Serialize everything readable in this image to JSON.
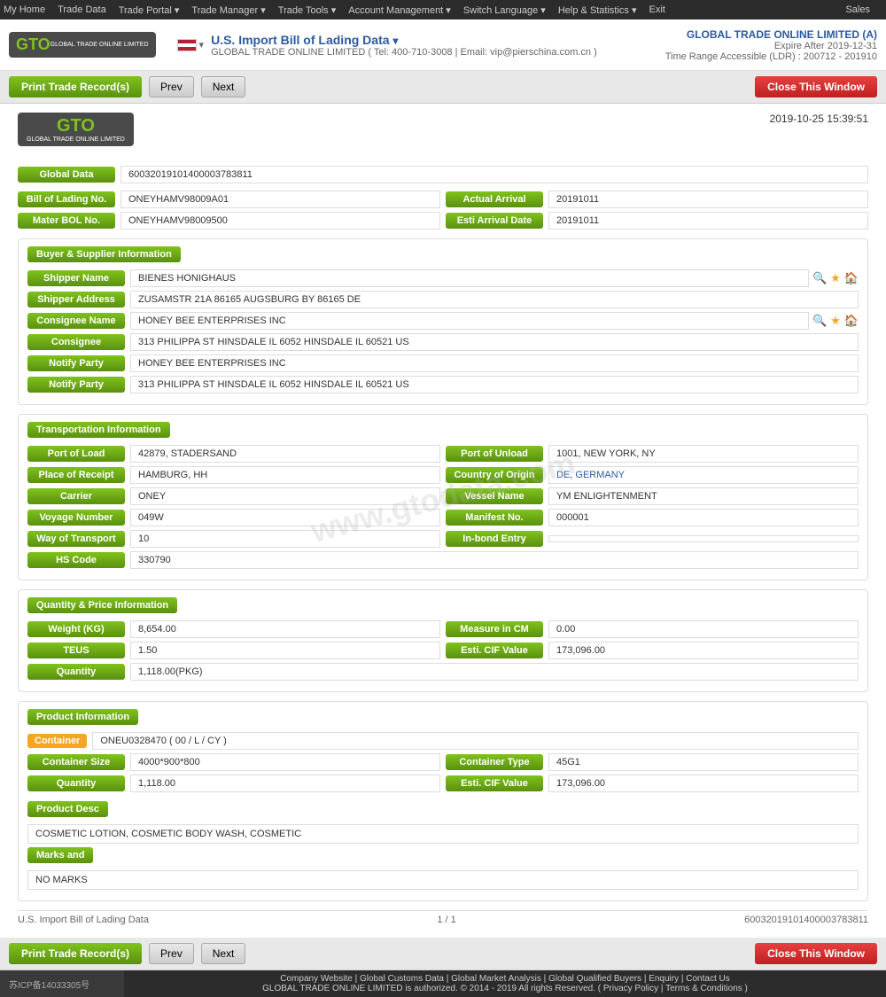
{
  "topnav": {
    "items": [
      "My Home",
      "Trade Data",
      "Trade Portal",
      "Trade Manager",
      "Trade Tools",
      "Account Management",
      "Switch Language",
      "Help & Statistics",
      "Exit"
    ],
    "sales": "Sales"
  },
  "header": {
    "logo_text": "GTO",
    "logo_sub": "GLOBAL TRADE ONLINE LIMITED",
    "flag_alt": "US Flag",
    "title": "U.S. Import Bill of Lading Data",
    "subtitle_company": "GLOBAL TRADE ONLINE LIMITED",
    "subtitle_tel": "Tel: 400-710-3008",
    "subtitle_email": "Email: vip@pierschina.com.cn",
    "account_name": "GLOBAL TRADE ONLINE LIMITED (A)",
    "expire": "Expire After 2019-12-31",
    "time_range": "Time Range Accessible (LDR) : 200712 - 201910"
  },
  "toolbar": {
    "print_label": "Print Trade Record(s)",
    "prev_label": "Prev",
    "next_label": "Next",
    "close_label": "Close This Window"
  },
  "doc": {
    "timestamp": "2019-10-25 15:39:51",
    "global_data_label": "Global Data",
    "global_data_value": "60032019101400003783811",
    "bol_label": "Bill of Lading No.",
    "bol_value": "ONEYHAMV98009A01",
    "actual_arrival_label": "Actual Arrival",
    "actual_arrival_value": "20191011",
    "master_bol_label": "Mater BOL No.",
    "master_bol_value": "ONEYHAMV98009500",
    "esti_arrival_label": "Esti Arrival Date",
    "esti_arrival_value": "20191011",
    "buyer_supplier_title": "Buyer & Supplier Information",
    "shipper_name_label": "Shipper Name",
    "shipper_name_value": "BIENES HONIGHAUS",
    "shipper_address_label": "Shipper Address",
    "shipper_address_value": "ZUSAMSTR 21A 86165 AUGSBURG BY 86165 DE",
    "consignee_name_label": "Consignee Name",
    "consignee_name_value": "HONEY BEE ENTERPRISES INC",
    "consignee_label": "Consignee",
    "consignee_value": "313 PHILIPPA ST HINSDALE IL 6052 HINSDALE IL 60521 US",
    "notify_party_label": "Notify Party",
    "notify_party_value": "HONEY BEE ENTERPRISES INC",
    "notify_party2_label": "Notify Party",
    "notify_party2_value": "313 PHILIPPA ST HINSDALE IL 6052 HINSDALE IL 60521 US",
    "transport_title": "Transportation Information",
    "port_of_load_label": "Port of Load",
    "port_of_load_value": "42879, STADERSAND",
    "port_of_unload_label": "Port of Unload",
    "port_of_unload_value": "1001, NEW YORK, NY",
    "place_of_receipt_label": "Place of Receipt",
    "place_of_receipt_value": "HAMBURG, HH",
    "country_of_origin_label": "Country of Origin",
    "country_of_origin_value": "DE, GERMANY",
    "carrier_label": "Carrier",
    "carrier_value": "ONEY",
    "vessel_name_label": "Vessel Name",
    "vessel_name_value": "YM ENLIGHTENMENT",
    "voyage_number_label": "Voyage Number",
    "voyage_number_value": "049W",
    "manifest_no_label": "Manifest No.",
    "manifest_no_value": "000001",
    "way_of_transport_label": "Way of Transport",
    "way_of_transport_value": "10",
    "in_bond_entry_label": "In-bond Entry",
    "in_bond_entry_value": "",
    "hs_code_label": "HS Code",
    "hs_code_value": "330790",
    "quantity_price_title": "Quantity & Price Information",
    "weight_label": "Weight (KG)",
    "weight_value": "8,654.00",
    "measure_cm_label": "Measure in CM",
    "measure_cm_value": "0.00",
    "teus_label": "TEUS",
    "teus_value": "1.50",
    "esti_cif_label": "Esti. CIF Value",
    "esti_cif_value": "173,096.00",
    "quantity_label": "Quantity",
    "quantity_value": "1,118.00(PKG)",
    "product_info_title": "Product Information",
    "container_label": "Container",
    "container_value": "ONEU0328470 ( 00 / L / CY )",
    "container_size_label": "Container Size",
    "container_size_value": "4000*900*800",
    "container_type_label": "Container Type",
    "container_type_value": "45G1",
    "quantity2_label": "Quantity",
    "quantity2_value": "1,118.00",
    "esti_cif2_label": "Esti. CIF Value",
    "esti_cif2_value": "173,096.00",
    "product_desc_label": "Product Desc",
    "product_desc_value": "COSMETIC LOTION, COSMETIC BODY WASH, COSMETIC",
    "marks_label": "Marks and",
    "marks_value": "NO MARKS",
    "footer_left": "U.S. Import Bill of Lading Data",
    "footer_mid": "1 / 1",
    "footer_right": "60032019101400003783811",
    "watermark": "www.gtodata.com"
  },
  "page_footer": {
    "links": "Company Website | Global Customs Data | Global Market Analysis | Global Qualified Buyers | Enquiry | Contact Us",
    "copyright": "GLOBAL TRADE ONLINE LIMITED is authorized. © 2014 - 2019 All rights Reserved.  (  Privacy Policy | Terms & Conditions  )",
    "icp": "苏ICP备14033305号"
  }
}
